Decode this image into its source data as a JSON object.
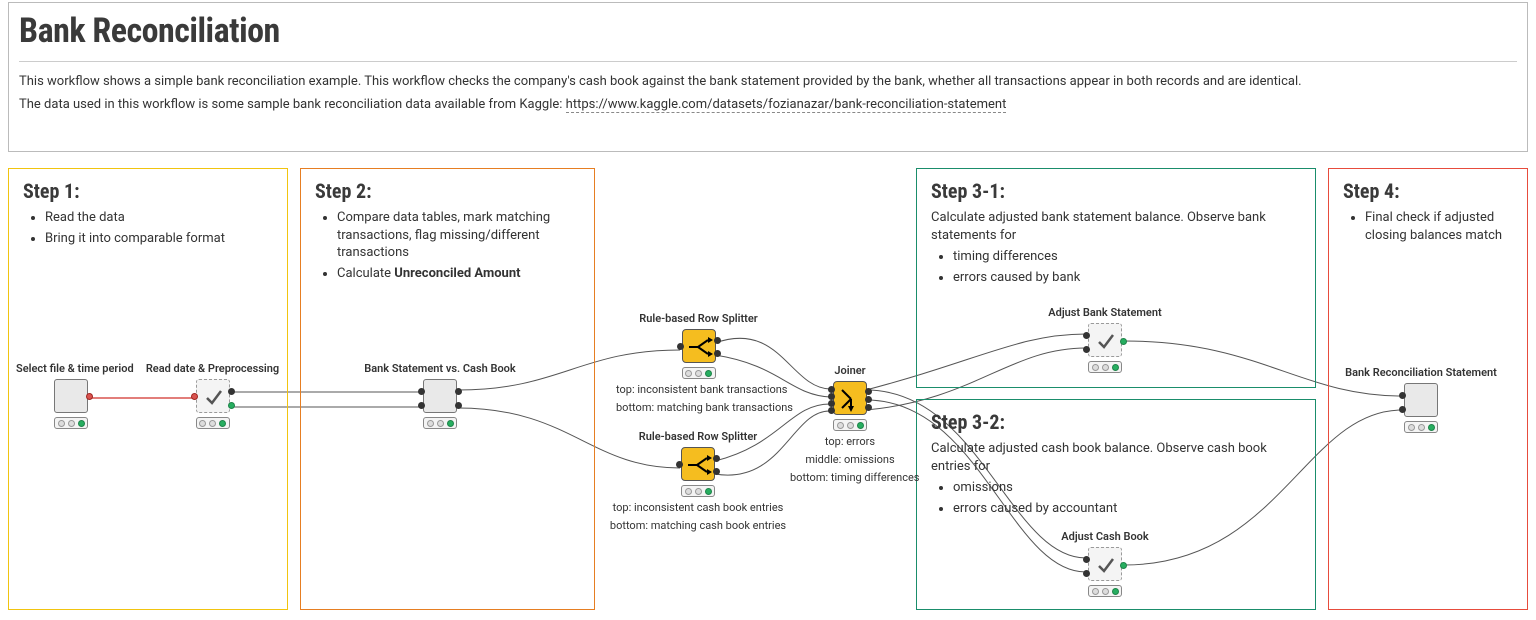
{
  "header": {
    "title": "Bank Reconciliation",
    "desc1": "This workflow shows a simple bank reconciliation example. This workflow checks the company's cash book against the bank statement provided by the bank, whether all transactions appear in both records and are identical.",
    "desc2_prefix": "The data used in this workflow is some sample bank reconciliation data available from Kaggle: ",
    "link_text": "https://www.kaggle.com/datasets/fozianazar/bank-reconciliation-statement"
  },
  "steps": {
    "s1": {
      "title": "Step 1:",
      "items": [
        "Read the data",
        "Bring it into comparable format"
      ]
    },
    "s2": {
      "title": "Step 2:",
      "item1": "Compare data tables, mark matching transactions, flag missing/different transactions",
      "item2_prefix": "Calculate ",
      "item2_bold": "Unreconciled Amount"
    },
    "s31": {
      "title": "Step 3-1:",
      "intro": "Calculate adjusted bank statement balance. Observe bank statements for",
      "items": [
        "timing differences",
        "errors caused by bank"
      ]
    },
    "s32": {
      "title": "Step 3-2:",
      "intro": "Calculate adjusted cash book balance. Observe cash book entries for",
      "items": [
        "omissions",
        "errors caused by accountant"
      ]
    },
    "s4": {
      "title": "Step 4:",
      "items": [
        "Final check if adjusted closing balances match"
      ]
    }
  },
  "nodes": {
    "select_file": "Select file & time period",
    "read_date": "Read date & Preprocessing",
    "bank_vs_cash": "Bank Statement vs. Cash Book",
    "splitter": "Rule-based Row Splitter",
    "splitter1_sub1": "top: inconsistent bank transactions",
    "splitter1_sub2": "bottom: matching bank transactions",
    "splitter2_sub1": "top: inconsistent cash book entries",
    "splitter2_sub2": "bottom: matching cash book entries",
    "joiner": "Joiner",
    "joiner_sub1": "top: errors",
    "joiner_sub2": "middle: omissions",
    "joiner_sub3": "bottom: timing differences",
    "adj_bank": "Adjust Bank Statement",
    "adj_cash": "Adjust Cash Book",
    "brs": "Bank Reconciliation Statement"
  }
}
